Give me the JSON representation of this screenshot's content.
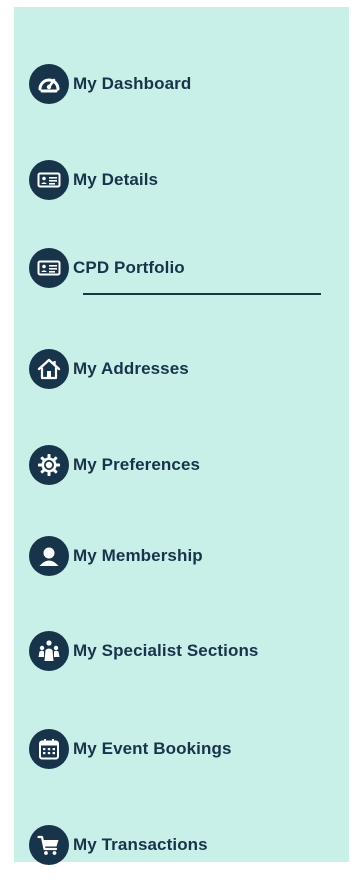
{
  "nav": {
    "items": [
      {
        "label": "My Dashboard",
        "icon": "dashboard-gauge-icon"
      },
      {
        "label": "My Details",
        "icon": "id-card-icon"
      },
      {
        "label": "CPD Portfolio",
        "icon": "id-card-icon",
        "active": true
      },
      {
        "label": "My Addresses",
        "icon": "home-icon"
      },
      {
        "label": "My Preferences",
        "icon": "gear-icon"
      },
      {
        "label": "My Membership",
        "icon": "user-icon"
      },
      {
        "label": "My Specialist Sections",
        "icon": "specialist-icon"
      },
      {
        "label": "My Event Bookings",
        "icon": "calendar-icon"
      },
      {
        "label": "My Transactions",
        "icon": "shopping-cart-icon"
      }
    ]
  },
  "colors": {
    "background": "#c8efe8",
    "accent": "#17344a"
  }
}
